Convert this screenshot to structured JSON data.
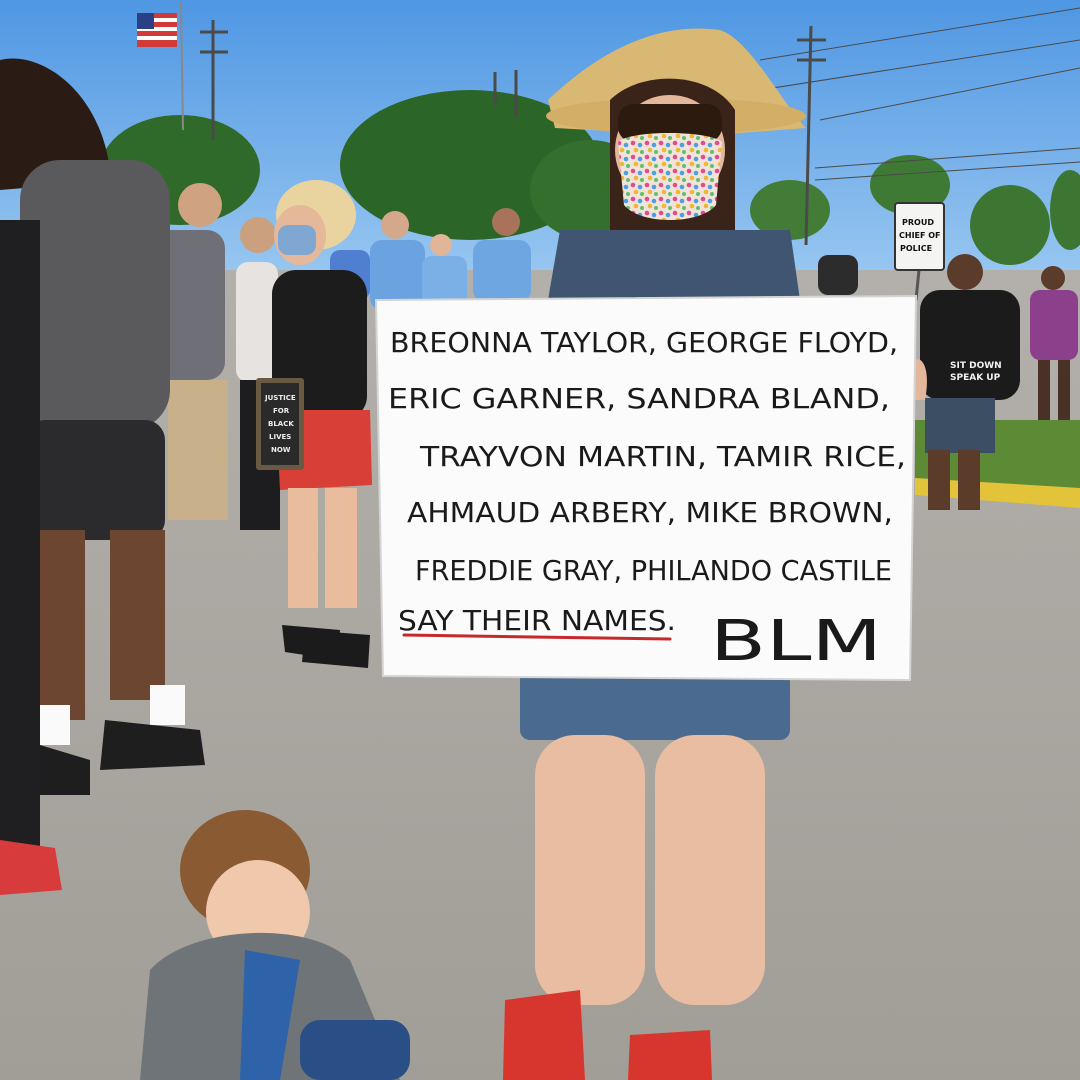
{
  "photo": {
    "sign": {
      "lines": [
        "BREONNA TAYLOR, GEORGE FLOYD,",
        "ERIC GARNER, SANDRA BLAND,",
        "TRAYVON MARTIN, TAMIR RICE,",
        "AHMAUD ARBERY, MIKE BROWN,",
        "FREDDIE GRAY, PHILANDO CASTILE"
      ],
      "closing": "SAY THEIR NAMES.",
      "tag": "BLM",
      "underline_color": "#c42a2a"
    },
    "letterboard": [
      "JUSTICE",
      "FOR",
      "BLACK",
      "LIVES",
      "NOW"
    ],
    "street_sign": [
      "PROUD",
      "CHIEF OF",
      "POLICE"
    ],
    "shirt_text": [
      "SIT DOWN",
      "SPEAK UP"
    ],
    "colors": {
      "sky": "#5fa6e8",
      "pavement": "#a9a59f",
      "grass": "#5d8a35",
      "curb": "#e3c33a",
      "mask_pattern": "#e9d9cf"
    }
  }
}
